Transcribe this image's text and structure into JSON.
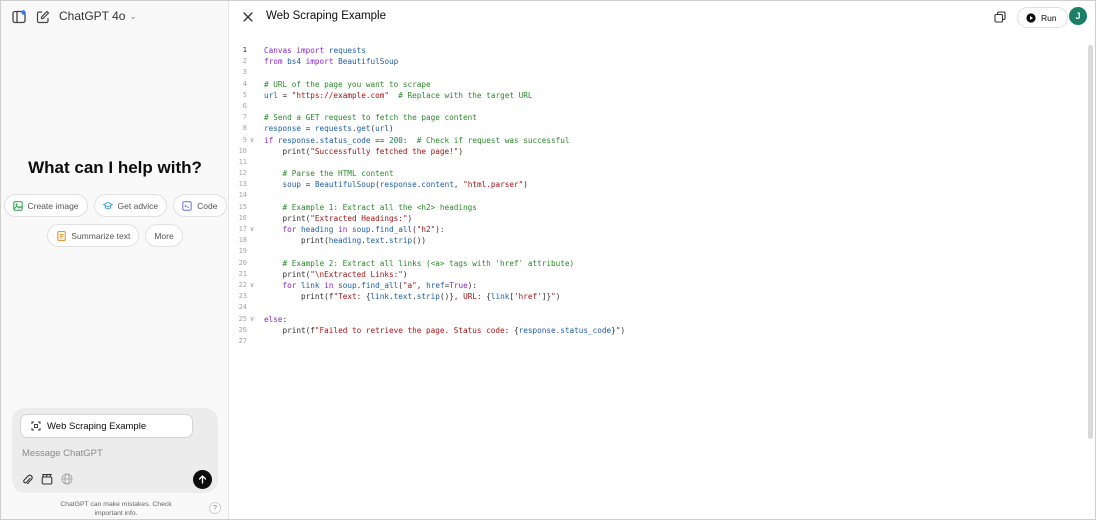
{
  "sidebar": {
    "model_name": "ChatGPT 4o",
    "hero_title": "What can I help with?",
    "chips_row1": [
      "Create image",
      "Get advice",
      "Code"
    ],
    "chips_row2": [
      "Summarize text",
      "More"
    ],
    "composer": {
      "canvas_label": "Web Scraping Example",
      "placeholder": "Message ChatGPT"
    },
    "disclaimer": "ChatGPT can make mistakes. Check important info.",
    "help_label": "?"
  },
  "canvas": {
    "title": "Web Scraping Example",
    "run_label": "Run",
    "avatar_initial": "J",
    "active_line": 1,
    "folded_lines": [
      9,
      17,
      22,
      25
    ],
    "lines": [
      [
        [
          "kw",
          "Canvas "
        ],
        [
          "kw",
          "import "
        ],
        [
          "id",
          "requests"
        ]
      ],
      [
        [
          "kw",
          "from "
        ],
        [
          "id",
          "bs4 "
        ],
        [
          "kw",
          "import "
        ],
        [
          "id",
          "BeautifulSoup"
        ]
      ],
      [],
      [
        [
          "cm",
          "# URL of the page you want to scrape"
        ]
      ],
      [
        [
          "id",
          "url "
        ],
        [
          "pl",
          "= "
        ],
        [
          "str",
          "\"https://example.com\""
        ],
        [
          "pl",
          "  "
        ],
        [
          "cm",
          "# Replace with the target URL"
        ]
      ],
      [],
      [
        [
          "cm",
          "# Send a GET request to fetch the page content"
        ]
      ],
      [
        [
          "id",
          "response "
        ],
        [
          "pl",
          "= "
        ],
        [
          "id",
          "requests"
        ],
        [
          "pl",
          "."
        ],
        [
          "id",
          "get"
        ],
        [
          "pl",
          "("
        ],
        [
          "id",
          "url"
        ],
        [
          "pl",
          ")"
        ]
      ],
      [
        [
          "kw",
          "if "
        ],
        [
          "id",
          "response"
        ],
        [
          "pl",
          "."
        ],
        [
          "id",
          "status_code "
        ],
        [
          "pl",
          "== "
        ],
        [
          "num",
          "200"
        ],
        [
          "pl",
          ":  "
        ],
        [
          "cm",
          "# Check if request was successful"
        ]
      ],
      [
        [
          "pl",
          "    print("
        ],
        [
          "str",
          "\"Successfully fetched the page!\""
        ],
        [
          "pl",
          ")"
        ]
      ],
      [],
      [
        [
          "pl",
          "    "
        ],
        [
          "cm",
          "# Parse the HTML content"
        ]
      ],
      [
        [
          "pl",
          "    "
        ],
        [
          "id",
          "soup "
        ],
        [
          "pl",
          "= "
        ],
        [
          "id",
          "BeautifulSoup"
        ],
        [
          "pl",
          "("
        ],
        [
          "id",
          "response"
        ],
        [
          "pl",
          "."
        ],
        [
          "id",
          "content"
        ],
        [
          "pl",
          ", "
        ],
        [
          "str",
          "\"html.parser\""
        ],
        [
          "pl",
          ")"
        ]
      ],
      [],
      [
        [
          "pl",
          "    "
        ],
        [
          "cm",
          "# Example 1: Extract all the <h2> headings"
        ]
      ],
      [
        [
          "pl",
          "    print("
        ],
        [
          "str",
          "\"Extracted Headings:\""
        ],
        [
          "pl",
          ")"
        ]
      ],
      [
        [
          "pl",
          "    "
        ],
        [
          "kw",
          "for "
        ],
        [
          "id",
          "heading "
        ],
        [
          "kw",
          "in "
        ],
        [
          "id",
          "soup"
        ],
        [
          "pl",
          "."
        ],
        [
          "id",
          "find_all"
        ],
        [
          "pl",
          "("
        ],
        [
          "str",
          "\"h2\""
        ],
        [
          "pl",
          "):"
        ]
      ],
      [
        [
          "pl",
          "        print("
        ],
        [
          "id",
          "heading"
        ],
        [
          "pl",
          "."
        ],
        [
          "id",
          "text"
        ],
        [
          "pl",
          "."
        ],
        [
          "id",
          "strip"
        ],
        [
          "pl",
          "())"
        ]
      ],
      [],
      [
        [
          "pl",
          "    "
        ],
        [
          "cm",
          "# Example 2: Extract all links (<a> tags with 'href' attribute)"
        ]
      ],
      [
        [
          "pl",
          "    print("
        ],
        [
          "str",
          "\"\\nExtracted Links:\""
        ],
        [
          "pl",
          ")"
        ]
      ],
      [
        [
          "pl",
          "    "
        ],
        [
          "kw",
          "for "
        ],
        [
          "id",
          "link "
        ],
        [
          "kw",
          "in "
        ],
        [
          "id",
          "soup"
        ],
        [
          "pl",
          "."
        ],
        [
          "id",
          "find_all"
        ],
        [
          "pl",
          "("
        ],
        [
          "str",
          "\"a\""
        ],
        [
          "pl",
          ", "
        ],
        [
          "id",
          "href"
        ],
        [
          "pl",
          "="
        ],
        [
          "kw",
          "True"
        ],
        [
          "pl",
          "):"
        ]
      ],
      [
        [
          "pl",
          "        print(f"
        ],
        [
          "str",
          "\"Text: "
        ],
        [
          "pl",
          "{"
        ],
        [
          "id",
          "link"
        ],
        [
          "pl",
          "."
        ],
        [
          "id",
          "text"
        ],
        [
          "pl",
          "."
        ],
        [
          "id",
          "strip"
        ],
        [
          "pl",
          "()}"
        ],
        [
          "str",
          ", URL: "
        ],
        [
          "pl",
          "{"
        ],
        [
          "id",
          "link"
        ],
        [
          "pl",
          "["
        ],
        [
          "str",
          "'href'"
        ],
        [
          "pl",
          "]}"
        ],
        [
          "str",
          "\""
        ],
        [
          "pl",
          ")"
        ]
      ],
      [],
      [
        [
          "kw",
          "else"
        ],
        [
          "pl",
          ":"
        ]
      ],
      [
        [
          "pl",
          "    print(f"
        ],
        [
          "str",
          "\"Failed to retrieve the page. Status code: "
        ],
        [
          "pl",
          "{"
        ],
        [
          "id",
          "response"
        ],
        [
          "pl",
          "."
        ],
        [
          "id",
          "status_code"
        ],
        [
          "pl",
          "}"
        ],
        [
          "str",
          "\""
        ],
        [
          "pl",
          ")"
        ]
      ],
      []
    ]
  }
}
